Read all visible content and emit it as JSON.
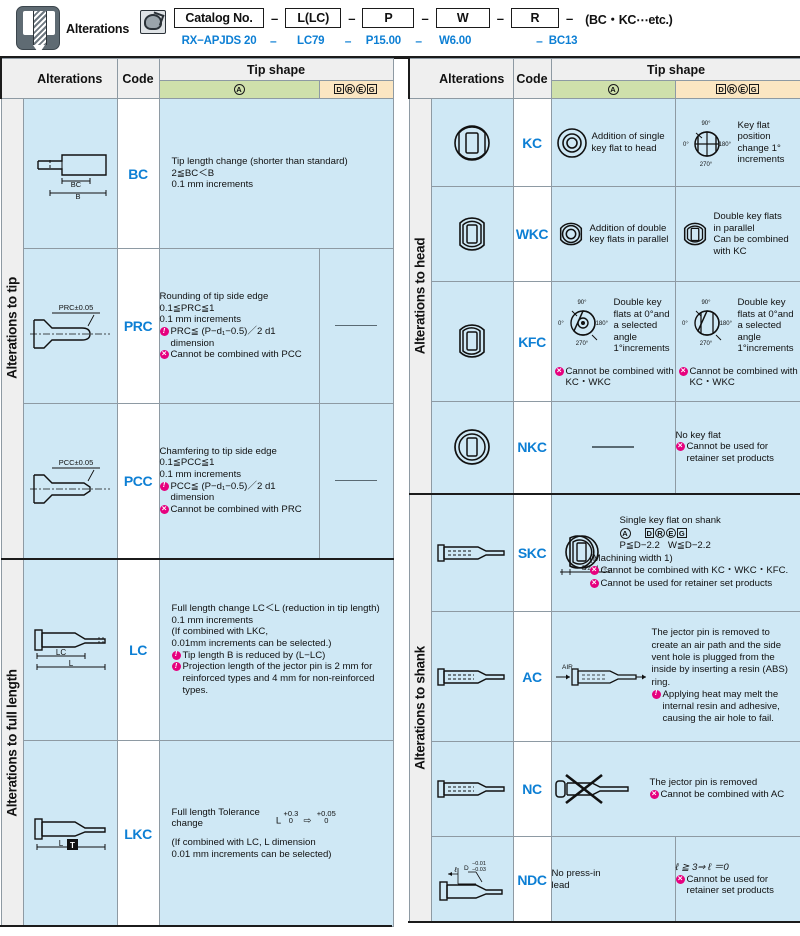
{
  "header": {
    "alterations_label": "Alterations",
    "logo_icon": "ejector-pin-icon",
    "phone_icon": "phone-contact-icon",
    "code_boxes": [
      "Catalog No.",
      "L(LC)",
      "P",
      "W",
      "R"
    ],
    "code_suffix": "(BC・KC⋯etc.)",
    "separator": "–",
    "values": [
      "RX−APJDS 20",
      "LC79",
      "P15.00",
      "W6.00",
      "",
      "BC13"
    ]
  },
  "table_headers": {
    "alterations": "Alterations",
    "code": "Code",
    "tip_shape": "Tip shape",
    "col_a": "A",
    "col_dreg": [
      "D",
      "R",
      "E",
      "G"
    ]
  },
  "left_table": {
    "sections": [
      {
        "title": "Alterations to tip",
        "rows": [
          {
            "code": "BC",
            "figure": "tip-length-change-diagram",
            "fig_labels": [
              "BC",
              "B"
            ],
            "col_a": {
              "lines": [
                "Tip length change (shorter than standard)",
                "2≦BC＜B",
                "0.1 mm increments"
              ]
            },
            "col_dreg": {
              "lines": []
            },
            "span_all": true
          },
          {
            "code": "PRC",
            "figure": "tip-side-edge-rounding-diagram",
            "fig_labels": [
              "PRC±0.05"
            ],
            "col_a": {
              "lines": [
                "Rounding of tip side edge",
                "0.1≦PRC≦1",
                "0.1 mm increments"
              ],
              "notes": [
                {
                  "icon": "warning",
                  "text": "PRC≦ (P−d₁−0.5)／2 d1 dimension"
                },
                {
                  "icon": "ban",
                  "text": "Cannot be combined with PCC"
                }
              ]
            },
            "col_dreg": {
              "dash": true
            }
          },
          {
            "code": "PCC",
            "figure": "tip-side-edge-chamfer-diagram",
            "fig_labels": [
              "PCC±0.05"
            ],
            "col_a": {
              "lines": [
                "Chamfering to tip side edge",
                "0.1≦PCC≦1",
                "0.1 mm increments"
              ],
              "notes": [
                {
                  "icon": "warning",
                  "text": "PCC≦ (P−d₁−0.5)／2 d1 dimension"
                },
                {
                  "icon": "ban",
                  "text": "Cannot be combined with PRC"
                }
              ]
            },
            "col_dreg": {
              "dash": true
            }
          }
        ]
      },
      {
        "title": "Alterations to full length",
        "rows": [
          {
            "code": "LC",
            "figure": "full-length-change-diagram",
            "fig_labels": [
              "LC",
              "L"
            ],
            "col_a": {
              "lines": [
                "Full length change LC＜L (reduction in tip length)",
                "0.1 mm increments",
                "(If combined with LKC,",
                "0.01mm increments can be selected.)"
              ],
              "notes": [
                {
                  "icon": "warning",
                  "text": "Tip length B is reduced by (L−LC)"
                },
                {
                  "icon": "warning",
                  "text": "Projection length of the jector pin is 2 mm for reinforced types and 4 mm for non-reinforced types."
                }
              ]
            },
            "span_all": true
          },
          {
            "code": "LKC",
            "figure": "full-length-tolerance-diagram",
            "fig_labels": [
              "L"
            ],
            "col_a": {
              "lines": [
                "Full length Tolerance",
                "change"
              ],
              "formula": "L +0.3 / 0  ⇒  +0.05 / 0",
              "extra": [
                "(If combined with LC, L dimension",
                "0.01 mm increments can be selected)"
              ]
            },
            "span_all": true
          }
        ]
      }
    ]
  },
  "right_table": {
    "sections": [
      {
        "title": "Alterations to head",
        "rows": [
          {
            "code": "KC",
            "figure": "head-single-key-flat-icon",
            "col_a": {
              "figure": "ring-circle-icon",
              "lines": [
                "Addition of single",
                "key flat to head"
              ]
            },
            "col_dreg": {
              "figure": "angle-dial-vertical-icon",
              "angles": [
                "90°",
                "0°",
                "180°",
                "270°"
              ],
              "lines": [
                "Key flat",
                "position",
                "change 1°",
                "increments"
              ]
            }
          },
          {
            "code": "WKC",
            "figure": "head-double-key-flat-icon",
            "col_a": {
              "figure": "ring-circle-icon",
              "lines": [
                "Addition of double",
                "key flats in parallel"
              ]
            },
            "col_dreg": {
              "figure": "head-double-key-flat-icon",
              "lines": [
                "Double key flats",
                "in parallel",
                "Can be combined",
                "with KC"
              ]
            }
          },
          {
            "code": "KFC",
            "figure": "head-angled-key-flat-icon",
            "col_a": {
              "figure": "angle-dial-round-icon",
              "angles": [
                "90°",
                "0°",
                "180°",
                "270°"
              ],
              "lines": [
                "Double key",
                "flats at 0°and",
                "a selected",
                "angle",
                "1°increments"
              ],
              "notes": [
                {
                  "icon": "ban",
                  "text": "Cannot be combined with KC・WKC"
                }
              ]
            },
            "col_dreg": {
              "figure": "angle-dial-vertical-icon",
              "angles": [
                "90°",
                "0°",
                "180°",
                "270°"
              ],
              "lines": [
                "Double key",
                "flats at 0°and",
                "a selected",
                "angle",
                "1°increments"
              ],
              "notes": [
                {
                  "icon": "ban",
                  "text": "Cannot be combined with KC・WKC"
                }
              ]
            }
          },
          {
            "code": "NKC",
            "figure": "head-no-key-flat-icon",
            "col_a": {
              "dash": true
            },
            "col_dreg": {
              "lines": [
                "No key flat"
              ],
              "notes": [
                {
                  "icon": "ban",
                  "text": "Cannot be used for retainer set products"
                }
              ]
            }
          }
        ]
      },
      {
        "title": "Alterations to shank",
        "rows": [
          {
            "code": "SKC",
            "figure": "shank-key-flat-side-diagram",
            "span_all": true,
            "merged": {
              "figure": "shank-key-flat-section-icon",
              "dim_label": "D⁄2 −1 −0.01",
              "title": "Single key flat on shank",
              "badge_a": "A",
              "badge_dreg": [
                "D",
                "R",
                "E",
                "G"
              ],
              "cond_a": "P≦D−2.2",
              "cond_dreg": "W≦D−2.2",
              "machining": "(Machining width 1)",
              "notes": [
                {
                  "icon": "ban",
                  "text": "Cannot be combined with KC・WKC・KFC."
                },
                {
                  "icon": "ban",
                  "text": "Cannot be used for retainer set products"
                }
              ]
            }
          },
          {
            "code": "AC",
            "figure": "shank-air-path-diagram",
            "span_all": true,
            "merged": {
              "figure": "shank-air-vent-diagram",
              "air_label": "AIR",
              "lines": [
                "The jector pin is removed to",
                "create an air path and the side",
                "vent hole is plugged from the",
                "inside by inserting a resin (ABS)",
                "ring."
              ],
              "notes": [
                {
                  "icon": "warning",
                  "text": "Applying heat may melt the internal resin and adhesive, causing the air hole to fail."
                }
              ]
            }
          },
          {
            "code": "NC",
            "figure": "shank-plain-diagram",
            "span_all": true,
            "merged": {
              "figure": "shank-pin-removed-crossed-diagram",
              "lines": [
                "The jector pin is removed"
              ],
              "notes": [
                {
                  "icon": "ban",
                  "text": "Cannot be combined with AC"
                }
              ]
            }
          },
          {
            "code": "NDC",
            "figure": "no-press-in-lead-diagram",
            "fig_labels": [
              "ℓ",
              "D−0.01/−0.03"
            ],
            "col_a": {
              "lines": [
                "No press-in",
                "lead"
              ]
            },
            "col_dreg": {
              "lines": [
                "ℓ ≧ 3⇒ ℓ ＝0"
              ],
              "notes": [
                {
                  "icon": "ban",
                  "text": "Cannot be used for retainer set products"
                }
              ]
            }
          }
        ]
      }
    ]
  },
  "colors": {
    "accent_blue": "#0d7fd4",
    "cell_blue": "#cfe8f5",
    "header_green": "#cfe0ab",
    "header_orange": "#fbe6c2",
    "header_gray": "#efefef",
    "note_magenta": "#e6007e"
  }
}
